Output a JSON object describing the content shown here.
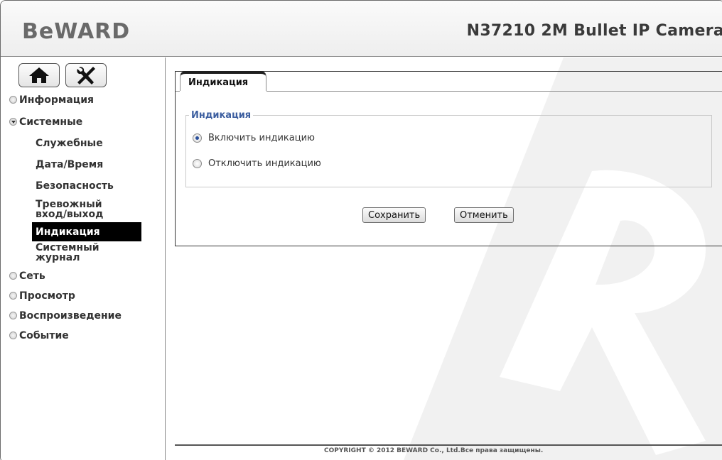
{
  "header": {
    "logo": "BeWARD",
    "model": "N37210 2M Bullet IP Camera"
  },
  "toolbar": {
    "home_icon": "home-icon",
    "tools_icon": "tools-icon"
  },
  "sidebar": {
    "sections": [
      {
        "label": "Информация",
        "expanded": false
      },
      {
        "label": "Системные",
        "expanded": true
      },
      {
        "label": "Сеть",
        "expanded": false
      },
      {
        "label": "Просмотр",
        "expanded": false
      },
      {
        "label": "Воспроизведение",
        "expanded": false
      },
      {
        "label": "Событие",
        "expanded": false
      }
    ],
    "system_items": [
      {
        "label": "Служебные"
      },
      {
        "label": "Дата/Время"
      },
      {
        "label": "Безопасность"
      },
      {
        "label": "Тревожный вход/выход"
      },
      {
        "label": "Индикация",
        "active": true
      },
      {
        "label": "Системный журнал"
      }
    ]
  },
  "main": {
    "tab_label": "Индикация",
    "group_legend": "Индикация",
    "options": [
      {
        "label": "Включить индикацию",
        "checked": true
      },
      {
        "label": "Отключить индикацию",
        "checked": false
      }
    ],
    "save_label": "Сохранить",
    "cancel_label": "Отменить"
  },
  "footer": {
    "copyright": "COPYRIGHT © 2012 BEWARD Co., Ltd.Все права защищены."
  },
  "colors": {
    "accent": "#3d5fa0",
    "active_bg": "#000000",
    "watermark": "#f1f1f1"
  }
}
